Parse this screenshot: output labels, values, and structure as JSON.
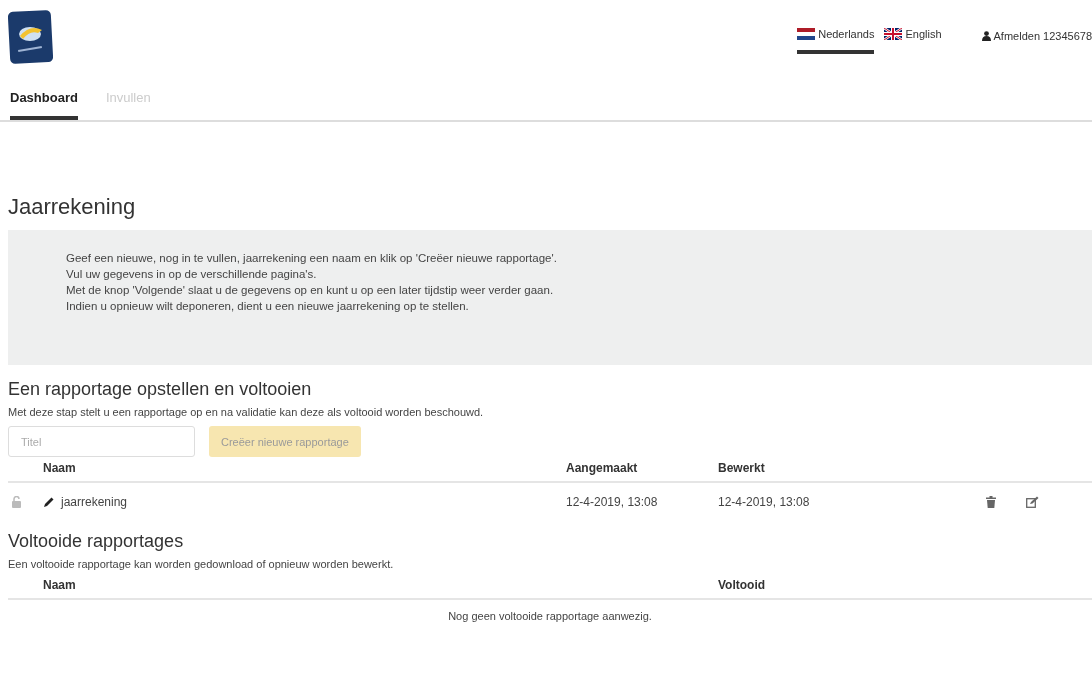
{
  "languages": [
    {
      "label": "Nederlands",
      "kind": "dutch",
      "selected": true
    },
    {
      "label": "English",
      "kind": "british",
      "selected": false
    }
  ],
  "user": {
    "label": "Afmelden 12345678"
  },
  "nav_tabs": [
    {
      "label": "Dashboard",
      "selected": true,
      "disabled": false
    },
    {
      "label": "Invullen",
      "selected": false,
      "disabled": true
    }
  ],
  "page_title": "Jaarrekening",
  "info_lines": [
    "Geef een nieuwe, nog in te vullen, jaarrekening een naam en klik op 'Creëer nieuwe rapportage'.",
    "Vul uw gegevens in op de verschillende pagina's.",
    "Met de knop 'Volgende' slaat u de gegevens op en kunt u op een later tijdstip weer verder gaan.",
    "Indien u opnieuw wilt deponeren, dient u een nieuwe jaarrekening op te stellen."
  ],
  "open_section": {
    "title": "Een rapportage opstellen en voltooien",
    "description": "Met deze stap stelt u een rapportage op en na validatie kan deze als voltooid worden beschouwd.",
    "title_field": {
      "placeholder": "Titel"
    },
    "create_button": {
      "label": "Creëer nieuwe rapportage",
      "disabled": true
    },
    "columns": [
      "Naam",
      "Aangemaakt",
      "Bewerkt"
    ],
    "rows": [
      {
        "name": "jaarrekening",
        "created": "12-4-2019, 13:08",
        "edited": "12-4-2019, 13:08",
        "locked": false
      }
    ]
  },
  "completed_section": {
    "title": "Voltooide rapportages",
    "description": "Een voltooide rapportage kan worden gedownload of opnieuw worden bewerkt.",
    "columns": [
      "Naam",
      "Voltooid"
    ],
    "empty_message": "Nog geen voltooide rapportage aanwezig."
  }
}
